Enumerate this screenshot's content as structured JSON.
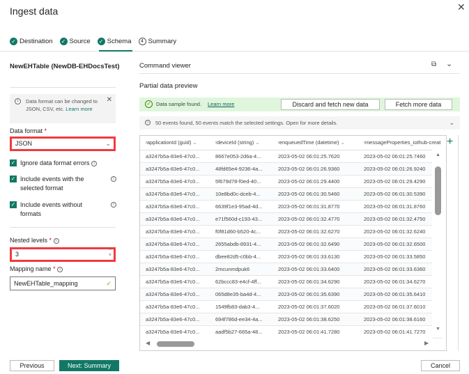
{
  "dialog": {
    "title": "Ingest data",
    "close_icon": "close-icon"
  },
  "tabs": [
    {
      "label": "Destination",
      "state": "done"
    },
    {
      "label": "Source",
      "state": "done"
    },
    {
      "label": "Schema",
      "state": "done",
      "selected": true
    },
    {
      "label": "Summary",
      "state": "pending",
      "number": "4"
    }
  ],
  "left": {
    "table_name": "NewEHTable (NewDB-EHDocsTest)",
    "info": {
      "text": "Data format can be changed to JSON, CSV, etc.",
      "link": "Learn more"
    },
    "data_format": {
      "label": "Data format",
      "required": "*",
      "value": "JSON"
    },
    "checkboxes": [
      {
        "label": "Ignore data format errors",
        "checked": true
      },
      {
        "label": "Include events with the selected format",
        "checked": true
      },
      {
        "label": "Include events without formats",
        "checked": true
      }
    ],
    "nested_levels": {
      "label": "Nested levels",
      "required": "*",
      "value": "3"
    },
    "mapping_name": {
      "label": "Mapping name",
      "required": "*",
      "value": "NewEHTable_mapping"
    }
  },
  "right": {
    "command_viewer": "Command viewer",
    "preview_title": "Partial data preview",
    "sample": {
      "text": "Data sample found.",
      "link": "Learn more",
      "discard": "Discard and fetch new data",
      "fetch": "Fetch more data"
    },
    "events": "50 events found, 50 events match the selected settings. Open for more details.",
    "columns": [
      "applicationId (guid)",
      "deviceId (string)",
      "enqueuedTime (datetime)",
      "messageProperties_iothub-creat"
    ],
    "rows": [
      [
        "a3247b5a-83e6-47c0...",
        "8667e053-2d6a-4...",
        "2023-05-02 06:01:25.7620",
        "2023-05-02 06:01:25.7460"
      ],
      [
        "a3247b5a-83e6-47c0...",
        "48fd65e4-9236-4a...",
        "2023-05-02 06:01:26.9360",
        "2023-05-02 06:01:26.9240"
      ],
      [
        "a3247b5a-83e6-47c0...",
        "5f679d78-f0ed-40...",
        "2023-05-02 06:01:29.4400",
        "2023-05-02 06:01:29.4290"
      ],
      [
        "a3247b5a-83e6-47c0...",
        "10e8bd0c-dceb-4...",
        "2023-05-02 06:01:30.5460",
        "2023-05-02 06:01:30.5390"
      ],
      [
        "a3247b5a-83e6-47c0...",
        "6639f1e3-95ad-4d...",
        "2023-05-02 06:01:31.8770",
        "2023-05-02 06:01:31.8760"
      ],
      [
        "a3247b5a-83e6-47c0...",
        "e71f560d-c193-43...",
        "2023-05-02 06:01:32.4770",
        "2023-05-02 06:01:32.4750"
      ],
      [
        "a3247b5a-83e6-47c0...",
        "f0f81d60-b520-4c...",
        "2023-05-02 06:01:32.6270",
        "2023-05-02 06:01:32.6240"
      ],
      [
        "a3247b5a-83e6-47c0...",
        "2655abdb-8931-4...",
        "2023-05-02 06:01:32.6490",
        "2023-05-02 06:01:32.6500"
      ],
      [
        "a3247b5a-83e6-47c0...",
        "dbee82d5-c0bb-4...",
        "2023-05-02 06:01:33.6130",
        "2023-05-02 06:01:33.5850"
      ],
      [
        "a3247b5a-83e6-47c0...",
        "2mcunmdpuk6",
        "2023-05-02 06:01:33.6400",
        "2023-05-02 06:01:33.6360"
      ],
      [
        "a3247b5a-83e6-47c0...",
        "62bccc83-e4cf-4ff...",
        "2023-05-02 06:01:34.6290",
        "2023-05-02 06:01:34.6270"
      ],
      [
        "a3247b5a-83e6-47c0...",
        "065d8e35-ba4d-4...",
        "2023-05-02 06:01:35.6390",
        "2023-05-02 06:01:35.6410"
      ],
      [
        "a3247b5a-83e6-47c0...",
        "1549fb83-dab3-4...",
        "2023-05-02 06:01:37.6020",
        "2023-05-02 06:01:37.6010"
      ],
      [
        "a3247b5a-83e6-47c0...",
        "694f786d-ee34-4a...",
        "2023-05-02 06:01:38.6250",
        "2023-05-02 06:01:38.6160"
      ],
      [
        "a3247b5a-83e6-47c0...",
        "aadf5b27-665a-48...",
        "2023-05-02 06:01:41.7280",
        "2023-05-02 06:01:41.7270"
      ]
    ]
  },
  "footer": {
    "previous": "Previous",
    "next": "Next: Summary",
    "cancel": "Cancel"
  },
  "colors": {
    "accent": "#117865",
    "highlight": "#f03a3f",
    "success_bg": "#dff6dd"
  }
}
